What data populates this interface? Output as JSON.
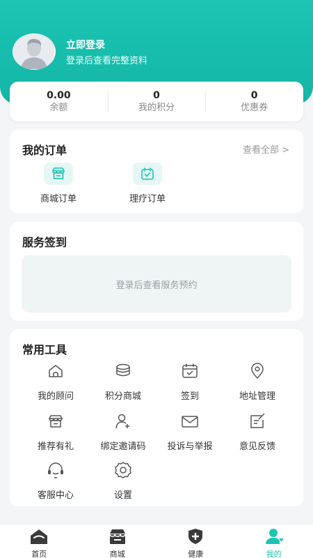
{
  "header": {
    "login_title": "立即登录",
    "login_subtitle": "登录后查看完整资料"
  },
  "stats": [
    {
      "value": "0.00",
      "label": "余额"
    },
    {
      "value": "0",
      "label": "我的积分"
    },
    {
      "value": "0",
      "label": "优惠券"
    }
  ],
  "orders": {
    "title": "我的订单",
    "view_all": "查看全部 >",
    "items": [
      {
        "label": "商城订单",
        "icon": "store-icon"
      },
      {
        "label": "理疗订单",
        "icon": "calendar-check-icon"
      }
    ]
  },
  "checkin": {
    "title": "服务签到",
    "placeholder": "登录后查看服务预约"
  },
  "tools": {
    "title": "常用工具",
    "items": [
      {
        "label": "我的顾问",
        "icon": "home-icon"
      },
      {
        "label": "积分商城",
        "icon": "coins-icon"
      },
      {
        "label": "签到",
        "icon": "calendar-check-icon"
      },
      {
        "label": "地址管理",
        "icon": "location-pin-icon"
      },
      {
        "label": "推荐有礼",
        "icon": "store-icon"
      },
      {
        "label": "绑定邀请码",
        "icon": "user-add-icon"
      },
      {
        "label": "投诉与举报",
        "icon": "mail-icon"
      },
      {
        "label": "意见反馈",
        "icon": "edit-icon"
      },
      {
        "label": "客服中心",
        "icon": "headset-icon"
      },
      {
        "label": "设置",
        "icon": "gear-icon"
      }
    ]
  },
  "tabbar": [
    {
      "label": "首页",
      "icon": "home-icon"
    },
    {
      "label": "商城",
      "icon": "shop-icon"
    },
    {
      "label": "健康",
      "icon": "shield-plus-icon"
    },
    {
      "label": "我的",
      "icon": "user-icon",
      "active": true
    }
  ],
  "colors": {
    "brand": "#1cc4b3",
    "icon_tint": "#e5f7f4"
  }
}
